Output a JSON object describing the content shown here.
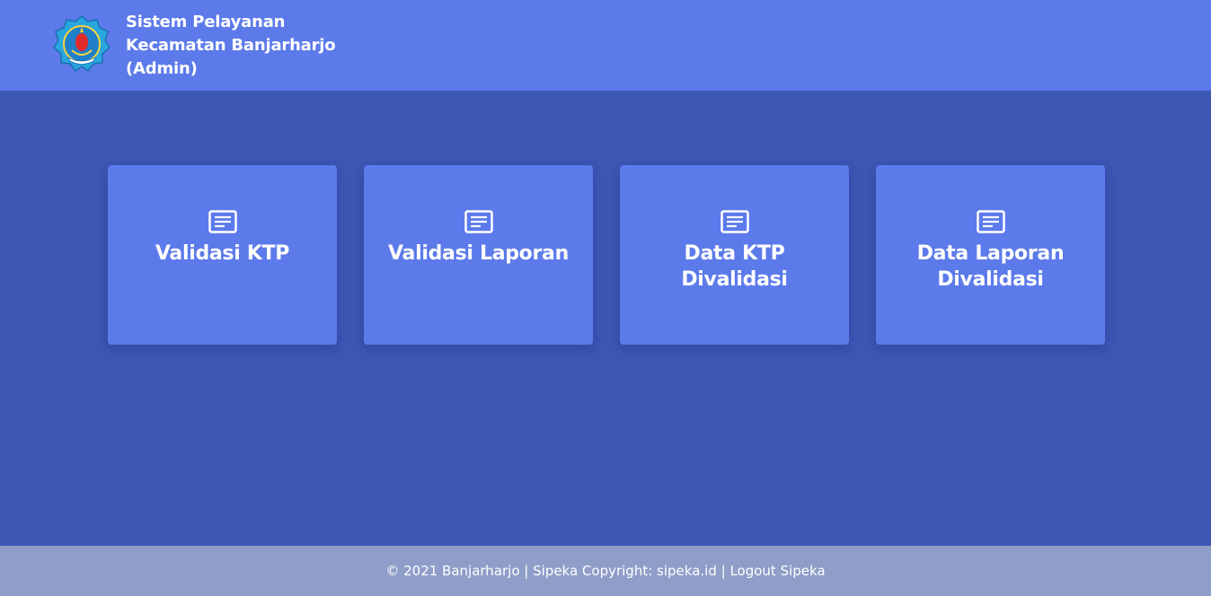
{
  "header": {
    "logo_icon": "kecamatan-emblem-icon",
    "title_lines": [
      "Sistem Pelayanan",
      "Kecamatan Banjarharjo",
      "(Admin)"
    ]
  },
  "cards": [
    {
      "label": "Validasi KTP",
      "icon": "document-lines-icon"
    },
    {
      "label": "Validasi Laporan",
      "icon": "document-lines-icon"
    },
    {
      "label": "Data KTP Divalidasi",
      "icon": "document-lines-icon"
    },
    {
      "label": "Data Laporan Divalidasi",
      "icon": "document-lines-icon"
    }
  ],
  "footer": {
    "copyright": "© 2021 Banjarharjo | Sipeka Copyright: ",
    "site_link": "sipeka.id",
    "separator": " | ",
    "logout_link": "Logout Sipeka"
  },
  "colors": {
    "header_bg": "#5c7aea",
    "main_bg": "#3d57b5",
    "card_bg": "#5c7aea",
    "footer_bg": "#8f9dc8"
  }
}
